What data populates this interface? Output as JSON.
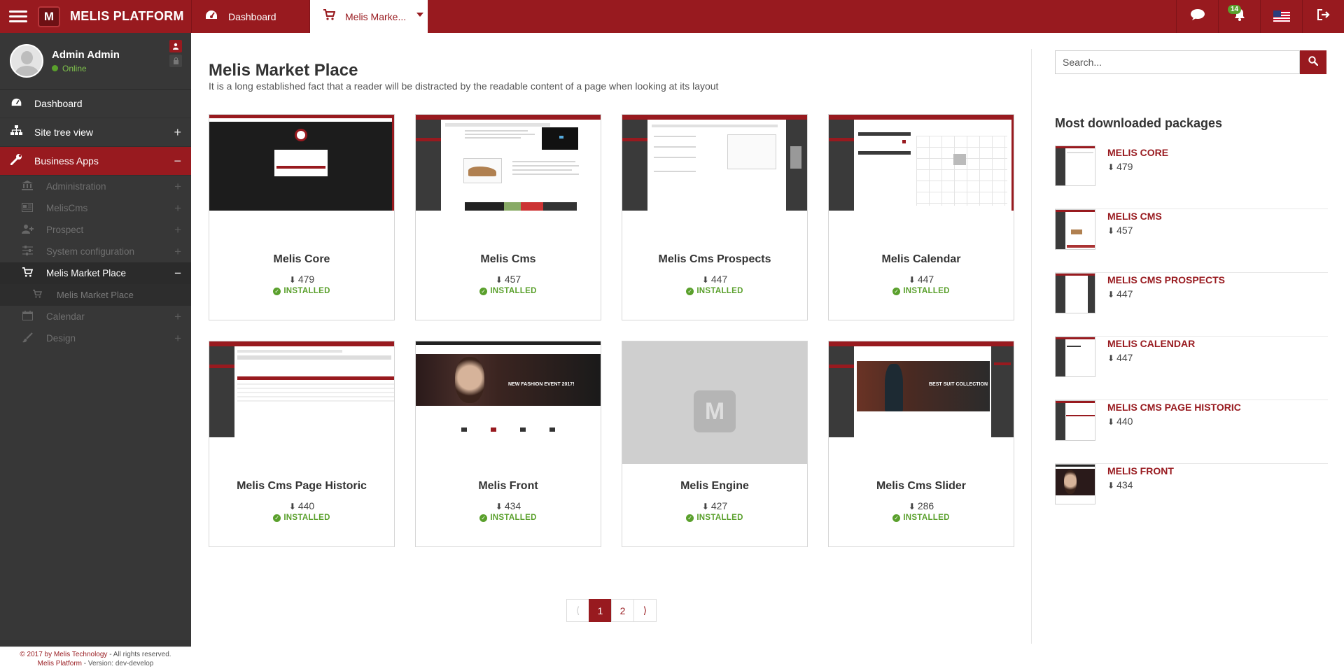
{
  "topbar": {
    "brand": "MELIS PLATFORM",
    "logo_letter": "M",
    "tabs": [
      {
        "label": "Dashboard"
      },
      {
        "label": "Melis Marke..."
      }
    ],
    "notification_count": "14",
    "accent": "#981a1f"
  },
  "user": {
    "name": "Admin Admin",
    "status": "Online"
  },
  "sidebar": {
    "items": [
      {
        "label": "Dashboard"
      },
      {
        "label": "Site tree view"
      },
      {
        "label": "Business Apps"
      }
    ],
    "subitems": [
      {
        "label": "Administration"
      },
      {
        "label": "MelisCms"
      },
      {
        "label": "Prospect"
      },
      {
        "label": "System configuration"
      },
      {
        "label": "Melis Market Place"
      },
      {
        "label": "Melis Market Place"
      },
      {
        "label": "Calendar"
      },
      {
        "label": "Design"
      }
    ]
  },
  "footer": {
    "line1_company": "© 2017 by Melis Technology",
    "line1_rest": " - All rights reserved.",
    "line2_product": "Melis Platform",
    "line2_rest": " - Version: dev-develop"
  },
  "main": {
    "title": "Melis Market Place",
    "subtitle": "It is a long established fact that a reader will be distracted by the readable content of a page when looking at its layout",
    "status_label": "INSTALLED",
    "packages": [
      {
        "name": "Melis Core",
        "downloads": "479"
      },
      {
        "name": "Melis Cms",
        "downloads": "457"
      },
      {
        "name": "Melis Cms Prospects",
        "downloads": "447"
      },
      {
        "name": "Melis Calendar",
        "downloads": "447"
      },
      {
        "name": "Melis Cms Page Historic",
        "downloads": "440"
      },
      {
        "name": "Melis Front",
        "downloads": "434"
      },
      {
        "name": "Melis Engine",
        "downloads": "427"
      },
      {
        "name": "Melis Cms Slider",
        "downloads": "286"
      }
    ],
    "thumb_texts": {
      "front": "NEW FASHION EVENT 2017!",
      "slider": "BEST SUIT COLLECTION",
      "engine_letter": "M"
    },
    "pagination": {
      "pages": [
        "1",
        "2"
      ],
      "current": "1",
      "prev": "⟨",
      "next": "⟩"
    }
  },
  "right": {
    "search_placeholder": "Search...",
    "title": "Most downloaded packages",
    "packages": [
      {
        "name": "MELIS CORE",
        "downloads": "479"
      },
      {
        "name": "MELIS CMS",
        "downloads": "457"
      },
      {
        "name": "MELIS CMS PROSPECTS",
        "downloads": "447"
      },
      {
        "name": "MELIS CALENDAR",
        "downloads": "447"
      },
      {
        "name": "MELIS CMS PAGE HISTORIC",
        "downloads": "440"
      },
      {
        "name": "MELIS FRONT",
        "downloads": "434"
      }
    ]
  },
  "icons": {
    "download": "download-icon",
    "check": "check-circle-icon",
    "search": "search-icon"
  }
}
